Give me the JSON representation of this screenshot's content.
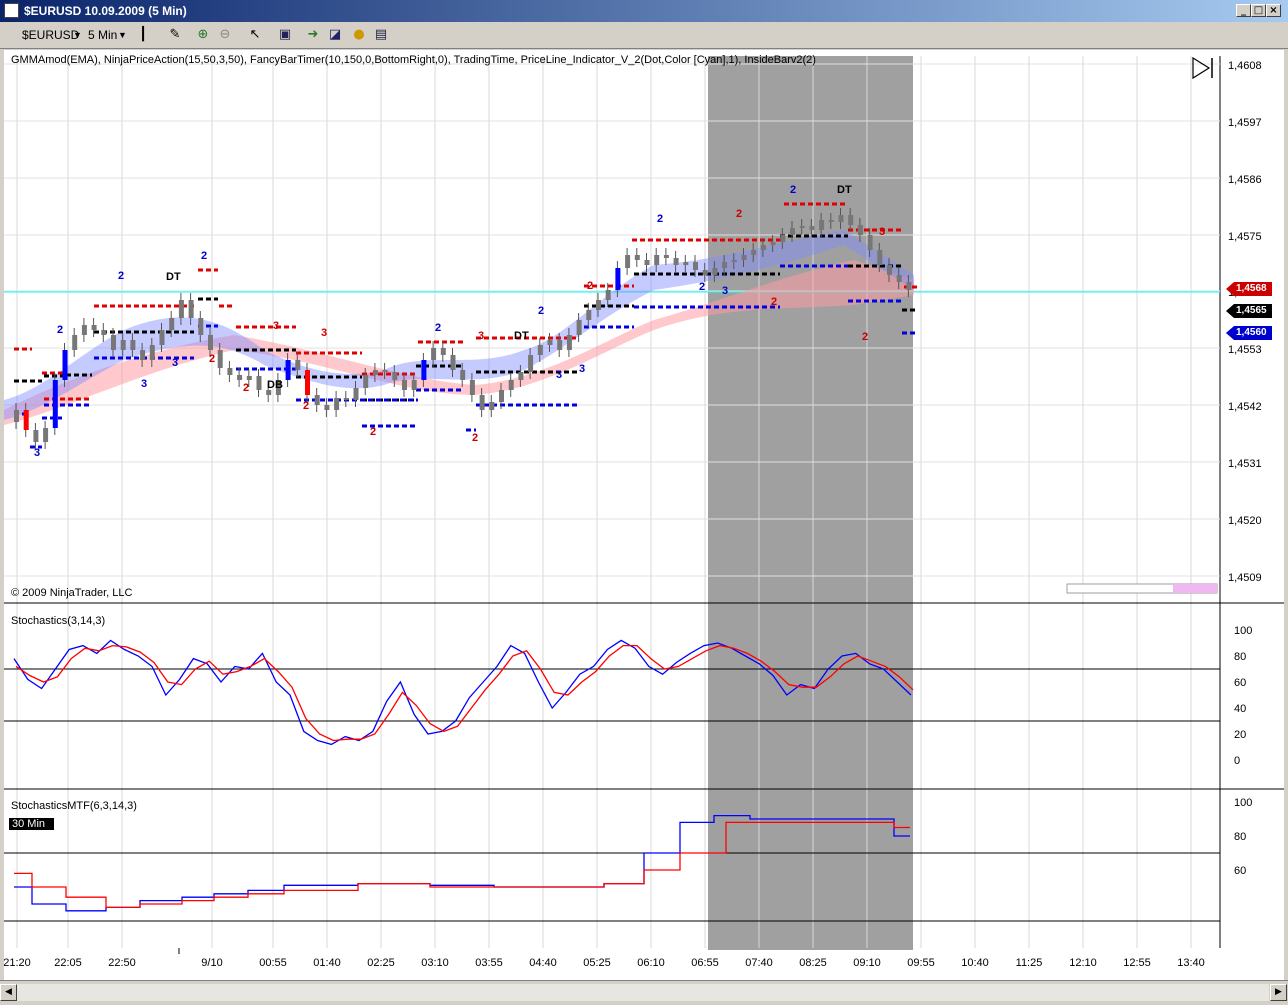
{
  "window": {
    "title": "$EURUSD  10.09.2009 (5 Min)"
  },
  "toolbar": {
    "instrument": "$EURUSD",
    "interval": "5 Min",
    "icons": [
      "candlestick-icon",
      "draw-pencil-icon",
      "zoom-in-icon",
      "zoom-out-icon",
      "cursor-icon",
      "properties-icon",
      "data-box-icon",
      "chart-trader-icon",
      "currency-icon",
      "order-icon"
    ]
  },
  "panel1": {
    "indicators": "GMMAmod(EMA), NinjaPriceAction(15,50,3,50), FancyBarTimer(10,150,0,BottomRight,0), TradingTime, PriceLine_Indicator_V_2(Dot,Color [Cyan],1), InsideBarv2(2)",
    "copyright": "© 2009 NinjaTrader, LLC",
    "price_ticks": [
      "1,4608",
      "1,4597",
      "1,4586",
      "1,4575",
      "1,4565",
      "1,4553",
      "1,4542",
      "1,4531",
      "1,4520",
      "1,4509"
    ],
    "price_badges": [
      {
        "text": "1,4568",
        "color": "#cc0000"
      },
      {
        "text": "1,4565",
        "color": "#000000"
      },
      {
        "text": "1,4560",
        "color": "#0000cc"
      }
    ],
    "signal_labels": [
      {
        "text": "2",
        "color": "blue"
      },
      {
        "text": "2",
        "color": "blue"
      },
      {
        "text": "DT",
        "color": "black"
      },
      {
        "text": "2",
        "color": "blue"
      },
      {
        "text": "2",
        "color": "red"
      },
      {
        "text": "3",
        "color": "blue"
      },
      {
        "text": "3",
        "color": "blue"
      },
      {
        "text": "3",
        "color": "blue"
      },
      {
        "text": "2",
        "color": "red"
      },
      {
        "text": "DB",
        "color": "black"
      },
      {
        "text": "3",
        "color": "red"
      },
      {
        "text": "3",
        "color": "red"
      },
      {
        "text": "2",
        "color": "red"
      },
      {
        "text": "2",
        "color": "blue"
      },
      {
        "text": "2",
        "color": "red"
      },
      {
        "text": "3",
        "color": "red"
      },
      {
        "text": "DT",
        "color": "black"
      },
      {
        "text": "2",
        "color": "red"
      },
      {
        "text": "2",
        "color": "blue"
      },
      {
        "text": "3",
        "color": "blue"
      },
      {
        "text": "3",
        "color": "blue"
      },
      {
        "text": "2",
        "color": "red"
      },
      {
        "text": "2",
        "color": "blue"
      },
      {
        "text": "2",
        "color": "blue"
      },
      {
        "text": "3",
        "color": "blue"
      },
      {
        "text": "2",
        "color": "red"
      },
      {
        "text": "2",
        "color": "red"
      },
      {
        "text": "2",
        "color": "blue"
      },
      {
        "text": "DT",
        "color": "black"
      },
      {
        "text": "3",
        "color": "red"
      },
      {
        "text": "2",
        "color": "red"
      }
    ]
  },
  "panel2": {
    "title": "Stochastics(3,14,3)",
    "ticks": [
      "100",
      "80",
      "60",
      "40",
      "20",
      "0"
    ],
    "levels": [
      70,
      30
    ]
  },
  "panel3": {
    "title": "StochasticsMTF(6,3,14,3)",
    "timeframe_badge": "30 Min",
    "ticks": [
      "100",
      "80",
      "60"
    ],
    "levels": [
      70,
      30
    ]
  },
  "time_axis": [
    "21:20",
    "22:05",
    "22:50",
    "9/10",
    "00:55",
    "01:40",
    "02:25",
    "03:10",
    "03:55",
    "04:40",
    "05:25",
    "06:10",
    "06:55",
    "07:40",
    "08:25",
    "09:10",
    "09:55",
    "10:40",
    "11:25",
    "12:10",
    "12:55",
    "13:40"
  ],
  "colors": {
    "up_bar": "#0000ff",
    "down_bar": "#ff0000",
    "price_line": "#00ffff",
    "session_shade": "#a0a0a0",
    "stoch_k": "#0000ff",
    "stoch_d": "#ff0000"
  }
}
